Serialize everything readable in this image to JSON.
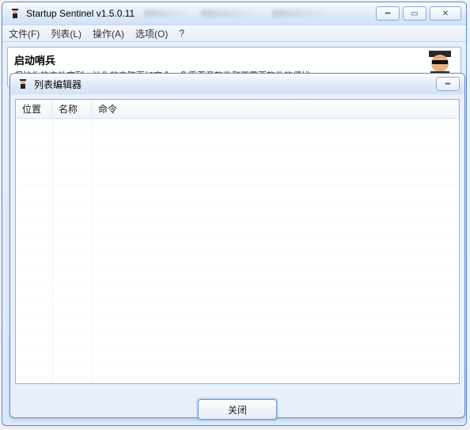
{
  "main_window": {
    "title": "Startup Sentinel v1.5.0.11",
    "menu": {
      "file": "文件(F)",
      "list": "列表(L)",
      "action": "操作(A)",
      "options": "选项(O)",
      "help": "?"
    },
    "banner": {
      "heading": "启动哨兵",
      "sub": "保护你的启动序列，让你的电脑更加安全，免受恶意软件和不需要软件的侵扰"
    }
  },
  "dialog": {
    "title": "列表编辑器",
    "columns": {
      "c1": "位置",
      "c2": "名称",
      "c3": "命令"
    },
    "close_label": "关闭"
  },
  "icons": {
    "app": "sentinel-icon",
    "minimize": "minimize-icon",
    "maximize": "maximize-icon",
    "close": "close-icon"
  }
}
